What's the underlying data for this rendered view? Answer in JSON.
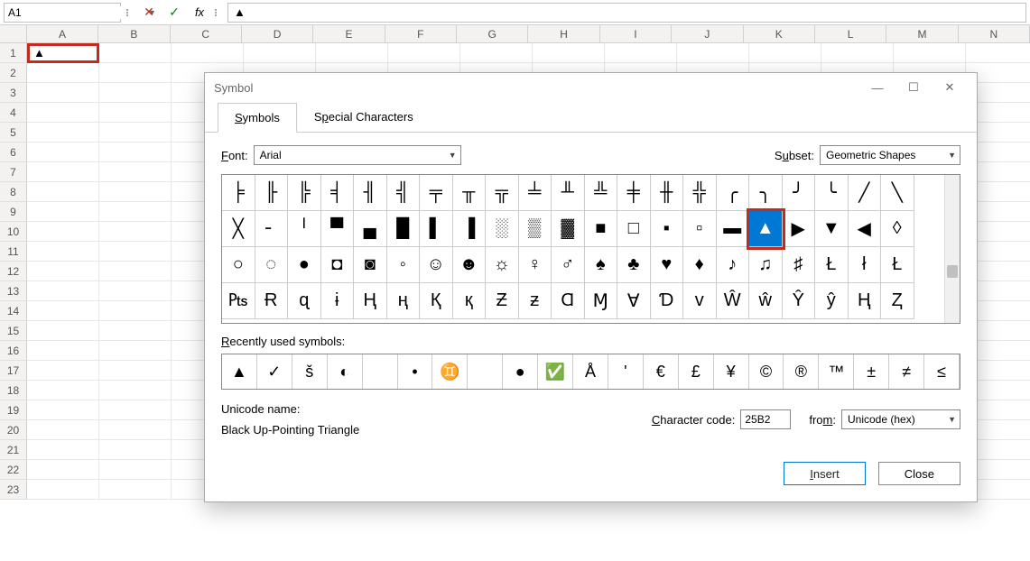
{
  "formula_bar": {
    "name_box": "A1",
    "formula": "▲"
  },
  "sheet": {
    "columns": [
      "A",
      "B",
      "C",
      "D",
      "E",
      "F",
      "G",
      "H",
      "I",
      "J",
      "K",
      "L",
      "M",
      "N"
    ],
    "rows": [
      "1",
      "2",
      "3",
      "4",
      "5",
      "6",
      "7",
      "8",
      "9",
      "10",
      "11",
      "12",
      "13",
      "14",
      "15",
      "16",
      "17",
      "18",
      "19",
      "20",
      "21",
      "22",
      "23"
    ],
    "active_cell_value": "▲"
  },
  "dialog": {
    "title": "Symbol",
    "tabs": {
      "symbols": "Symbols",
      "special": "Special Characters"
    },
    "font_label": "Font:",
    "font_value": "Arial",
    "subset_label": "Subset:",
    "subset_value": "Geometric Shapes",
    "symbols": [
      "╞",
      "╟",
      "╠",
      "╡",
      "╢",
      "╣",
      "╤",
      "╥",
      "╦",
      "╧",
      "╨",
      "╩",
      "╪",
      "╫",
      "╬",
      "╭",
      "╮",
      "╯",
      "╰",
      "╱",
      "╲",
      "╳",
      "╴",
      "╵",
      "▀",
      "▄",
      "█",
      "▌",
      "▐",
      "░",
      "▒",
      "▓",
      "■",
      "□",
      "▪",
      "▫",
      "▬",
      "▲",
      "▶",
      "▼",
      "◀",
      "◊",
      "○",
      "◌",
      "●",
      "◘",
      "◙",
      "◦",
      "☺",
      "☻",
      "☼",
      "♀",
      "♂",
      "♠",
      "♣",
      "♥",
      "♦",
      "♪",
      "♫",
      "♯",
      "Ł",
      "ł",
      "Ł",
      "₧",
      "Ɍ",
      "ɋ",
      "ɨ",
      "Ң",
      "ң",
      "Қ",
      "қ",
      "Ƶ",
      "ƶ",
      "Ɑ",
      "Ɱ",
      "∀",
      "Ɗ",
      "ᴠ",
      "Ŵ",
      "ŵ",
      "Ŷ",
      "ŷ",
      "Ⱨ",
      "Ⱬ"
    ],
    "selected_index": 37,
    "recent_label": "Recently used symbols:",
    "recent": [
      "▲",
      "✓",
      "š",
      "◐",
      "",
      "•",
      "♊",
      "",
      "●",
      "✅",
      "Å",
      "'",
      "€",
      "£",
      "¥",
      "©",
      "®",
      "™",
      "±",
      "≠",
      "≤"
    ],
    "unicode_name_label": "Unicode name:",
    "unicode_name": "Black Up-Pointing Triangle",
    "char_code_label": "Character code:",
    "char_code": "25B2",
    "from_label": "from:",
    "from_value": "Unicode (hex)",
    "insert": "Insert",
    "close": "Close"
  }
}
